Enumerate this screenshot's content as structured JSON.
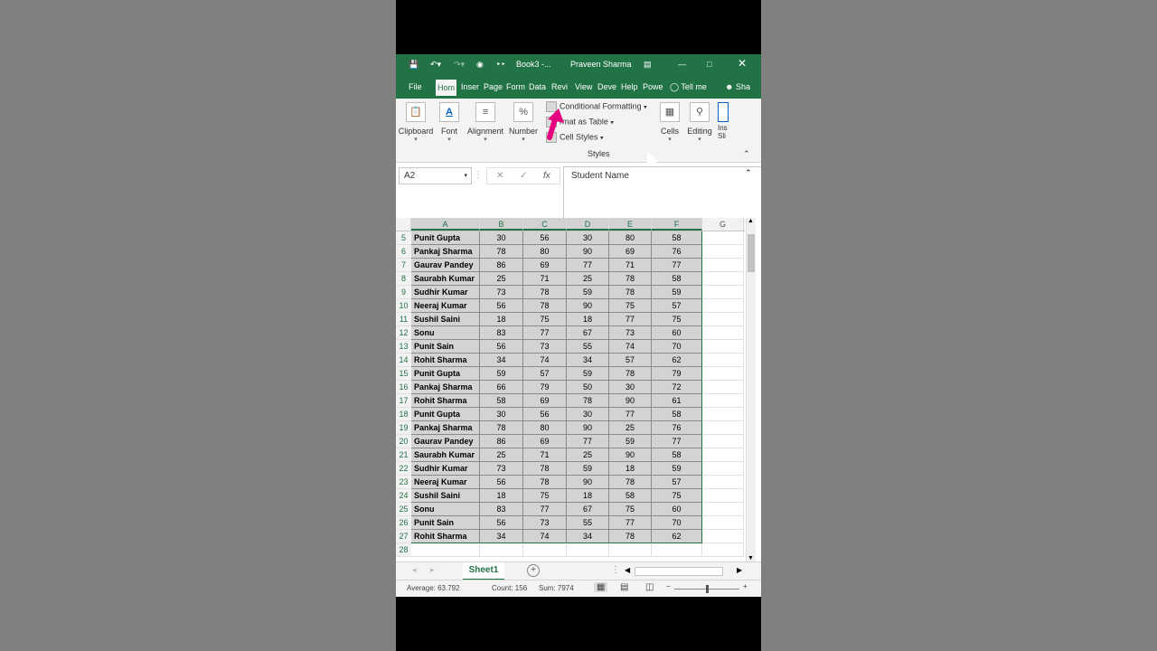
{
  "title_bar": {
    "book": "Book3  -...",
    "user": "Praveen Sharma",
    "colors": {
      "excel_green": "#217346"
    }
  },
  "tabs": [
    {
      "label": "File",
      "active": false
    },
    {
      "label": "Hom",
      "active": true
    },
    {
      "label": "Inser",
      "active": false
    },
    {
      "label": "Page",
      "active": false
    },
    {
      "label": "Form",
      "active": false
    },
    {
      "label": "Data",
      "active": false
    },
    {
      "label": "Revi",
      "active": false
    },
    {
      "label": "View",
      "active": false
    },
    {
      "label": "Deve",
      "active": false
    },
    {
      "label": "Help",
      "active": false
    },
    {
      "label": "Powe",
      "active": false
    },
    {
      "label": "Tell me",
      "active": false
    },
    {
      "label": "Sha",
      "active": false
    }
  ],
  "ribbon": {
    "clipboard": "Clipboard",
    "font": "Font",
    "alignment": "Alignment",
    "number": "Number",
    "conditional_formatting": "Conditional Formatting",
    "format_as_table": "rmat as Table",
    "cell_styles": "Cell Styles",
    "styles_group": "Styles",
    "cells": "Cells",
    "editing": "Editing",
    "ins": "Ins",
    "sli": "Sli"
  },
  "formula_bar": {
    "name_box": "A2",
    "fx": "fx",
    "content": "Student Name"
  },
  "columns": [
    "A",
    "B",
    "C",
    "D",
    "E",
    "F",
    "G"
  ],
  "rows": [
    {
      "n": "5",
      "cells": [
        "Punit Gupta",
        "30",
        "56",
        "30",
        "80",
        "58"
      ]
    },
    {
      "n": "6",
      "cells": [
        "Pankaj Sharma",
        "78",
        "80",
        "90",
        "69",
        "76"
      ]
    },
    {
      "n": "7",
      "cells": [
        "Gaurav Pandey",
        "86",
        "69",
        "77",
        "71",
        "77"
      ]
    },
    {
      "n": "8",
      "cells": [
        "Saurabh Kumar",
        "25",
        "71",
        "25",
        "78",
        "58"
      ]
    },
    {
      "n": "9",
      "cells": [
        "Sudhir Kumar",
        "73",
        "78",
        "59",
        "78",
        "59"
      ]
    },
    {
      "n": "10",
      "cells": [
        "Neeraj Kumar",
        "56",
        "78",
        "90",
        "75",
        "57"
      ]
    },
    {
      "n": "11",
      "cells": [
        "Sushil Saini",
        "18",
        "75",
        "18",
        "77",
        "75"
      ]
    },
    {
      "n": "12",
      "cells": [
        "Sonu",
        "83",
        "77",
        "67",
        "73",
        "60"
      ]
    },
    {
      "n": "13",
      "cells": [
        "Punit Sain",
        "56",
        "73",
        "55",
        "74",
        "70"
      ]
    },
    {
      "n": "14",
      "cells": [
        "Rohit Sharma",
        "34",
        "74",
        "34",
        "57",
        "62"
      ]
    },
    {
      "n": "15",
      "cells": [
        "Punit Gupta",
        "59",
        "57",
        "59",
        "78",
        "79"
      ]
    },
    {
      "n": "16",
      "cells": [
        "Pankaj Sharma",
        "66",
        "79",
        "50",
        "30",
        "72"
      ]
    },
    {
      "n": "17",
      "cells": [
        "Rohit Sharma",
        "58",
        "69",
        "78",
        "90",
        "61"
      ]
    },
    {
      "n": "18",
      "cells": [
        "Punit Gupta",
        "30",
        "56",
        "30",
        "77",
        "58"
      ]
    },
    {
      "n": "19",
      "cells": [
        "Pankaj Sharma",
        "78",
        "80",
        "90",
        "25",
        "76"
      ]
    },
    {
      "n": "20",
      "cells": [
        "Gaurav Pandey",
        "86",
        "69",
        "77",
        "59",
        "77"
      ]
    },
    {
      "n": "21",
      "cells": [
        "Saurabh Kumar",
        "25",
        "71",
        "25",
        "90",
        "58"
      ]
    },
    {
      "n": "22",
      "cells": [
        "Sudhir Kumar",
        "73",
        "78",
        "59",
        "18",
        "59"
      ]
    },
    {
      "n": "23",
      "cells": [
        "Neeraj Kumar",
        "56",
        "78",
        "90",
        "78",
        "57"
      ]
    },
    {
      "n": "24",
      "cells": [
        "Sushil Saini",
        "18",
        "75",
        "18",
        "58",
        "75"
      ]
    },
    {
      "n": "25",
      "cells": [
        "Sonu",
        "83",
        "77",
        "67",
        "75",
        "60"
      ]
    },
    {
      "n": "26",
      "cells": [
        "Punit Sain",
        "56",
        "73",
        "55",
        "77",
        "70"
      ]
    },
    {
      "n": "27",
      "cells": [
        "Rohit Sharma",
        "34",
        "74",
        "34",
        "78",
        "62"
      ]
    },
    {
      "n": "28",
      "cells": []
    }
  ],
  "sheet_tab": "Sheet1",
  "status": {
    "average": "Average: 63.792",
    "count": "Count: 156",
    "sum": "Sum: 7974"
  }
}
